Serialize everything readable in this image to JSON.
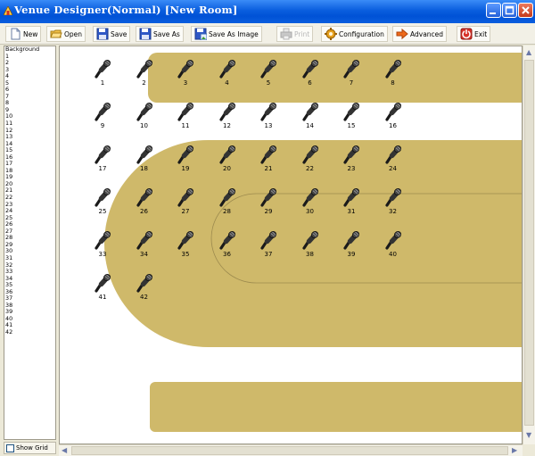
{
  "window": {
    "title": "Venue Designer(Normal) [New Room]"
  },
  "toolbar": {
    "new_label": "New",
    "open_label": "Open",
    "save_label": "Save",
    "save_as_label": "Save As",
    "save_as_image_label": "Save As Image",
    "print_label": "Print",
    "configuration_label": "Configuration",
    "advanced_label": "Advanced",
    "exit_label": "Exit"
  },
  "sidebar": {
    "items": [
      "Background",
      "1",
      "2",
      "3",
      "4",
      "5",
      "6",
      "7",
      "8",
      "9",
      "10",
      "11",
      "12",
      "13",
      "14",
      "15",
      "16",
      "17",
      "18",
      "19",
      "20",
      "21",
      "22",
      "23",
      "24",
      "25",
      "26",
      "27",
      "28",
      "29",
      "30",
      "31",
      "32",
      "33",
      "34",
      "35",
      "36",
      "37",
      "38",
      "39",
      "40",
      "41",
      "42"
    ],
    "show_grid_label": "Show Grid",
    "show_grid_checked": false
  },
  "canvas": {
    "background_color": "#ffffff",
    "table_color": "#cfb96a",
    "outline_color": "#9c8a4e",
    "microphones": [
      "1",
      "2",
      "3",
      "4",
      "5",
      "6",
      "7",
      "8",
      "9",
      "10",
      "11",
      "12",
      "13",
      "14",
      "15",
      "16",
      "17",
      "18",
      "19",
      "20",
      "21",
      "22",
      "23",
      "24",
      "25",
      "26",
      "27",
      "28",
      "29",
      "30",
      "31",
      "32",
      "33",
      "34",
      "35",
      "36",
      "37",
      "38",
      "39",
      "40",
      "41",
      "42"
    ],
    "mic_icon": "microphone-icon"
  },
  "colors": {
    "titlebar_blue": "#0a5ede",
    "toolbar_bg": "#f2f0e6"
  }
}
